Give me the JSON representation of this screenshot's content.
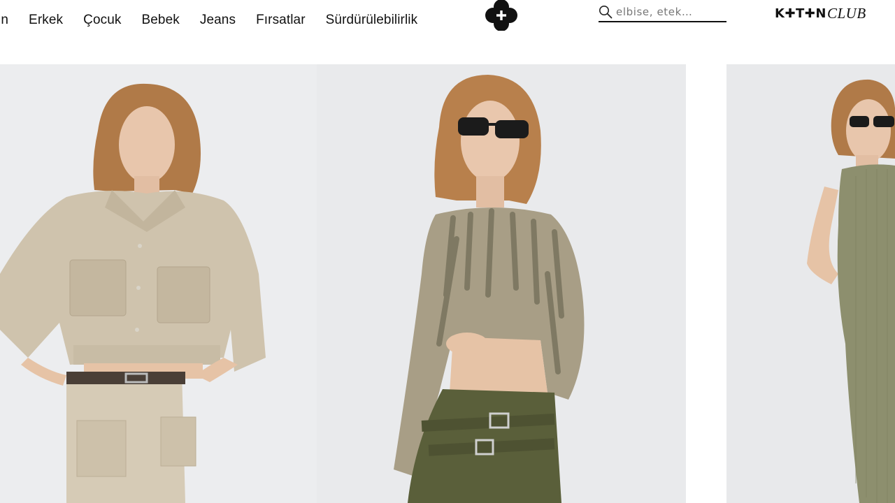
{
  "nav": {
    "items": [
      {
        "label": "ın"
      },
      {
        "label": "Erkek"
      },
      {
        "label": "Çocuk"
      },
      {
        "label": "Bebek"
      },
      {
        "label": "Jeans"
      },
      {
        "label": "Fırsatlar"
      },
      {
        "label": "Sürdürülebilirlik"
      }
    ]
  },
  "search": {
    "placeholder": "elbise, etek…",
    "value": ""
  },
  "club_logo": {
    "koton": "K✚T✚N",
    "club": "CLUB"
  },
  "icons": {
    "brand": "koton-flower-icon",
    "search": "search-icon"
  },
  "products": [
    {
      "name": "product-card-cargo-jacket-set",
      "colors": {
        "garment": "#cfc3ad",
        "background": "#ecedef"
      }
    },
    {
      "name": "product-card-mesh-top",
      "colors": {
        "garment": "#9a8f78",
        "trousers": "#5a5f3a",
        "background": "#e9eaec"
      }
    },
    {
      "name": "product-card-knit-dress",
      "colors": {
        "garment": "#8d8f6e",
        "background": "#e8e9eb"
      }
    }
  ]
}
